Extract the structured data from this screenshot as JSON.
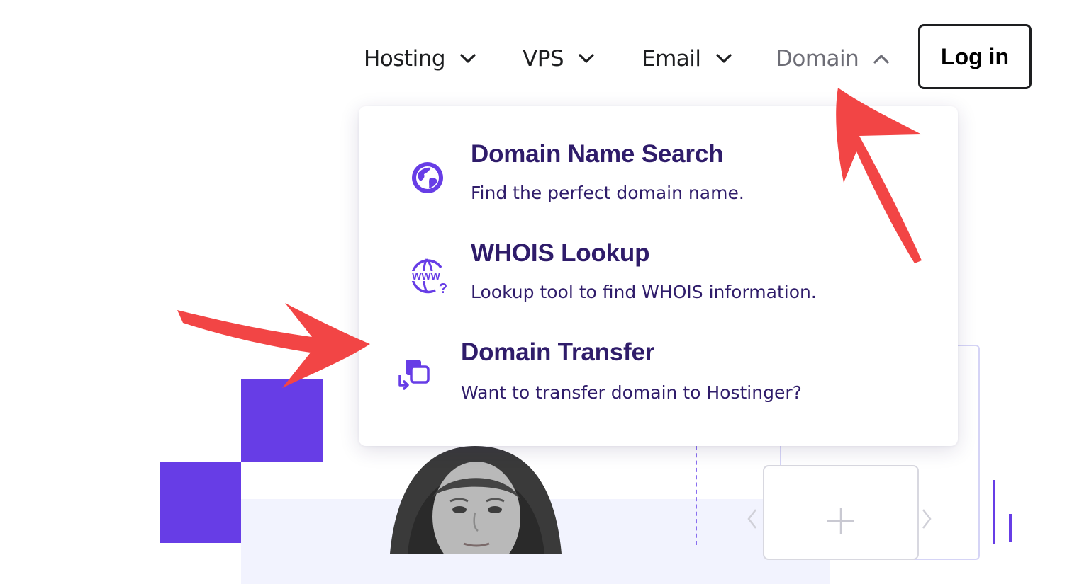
{
  "nav": {
    "items": [
      {
        "label": "Hosting",
        "icon": "chevron-down-icon"
      },
      {
        "label": "VPS",
        "icon": "chevron-down-icon"
      },
      {
        "label": "Email",
        "icon": "chevron-down-icon"
      },
      {
        "label": "Domain",
        "icon": "chevron-up-icon",
        "active": true
      }
    ],
    "login_label": "Log in"
  },
  "domain_menu": {
    "items": [
      {
        "title": "Domain Name Search",
        "description": "Find the perfect domain name.",
        "icon": "globe-icon"
      },
      {
        "title": "WHOIS Lookup",
        "description": "Lookup tool to find WHOIS information.",
        "icon": "www-question-icon"
      },
      {
        "title": "Domain Transfer",
        "description": "Want to transfer domain to Hostinger?",
        "icon": "domain-transfer-icon"
      }
    ]
  },
  "hero": {
    "plus_card_icon": "plus-icon",
    "carousel_icons": [
      "chevron-left-icon",
      "chevron-right-icon"
    ]
  },
  "colors": {
    "brand_purple": "#673de6",
    "menu_text": "#2f1c6a",
    "nav_text": "#1d1e20",
    "nav_active": "#6d6d76",
    "annotation_red": "#f24545"
  }
}
